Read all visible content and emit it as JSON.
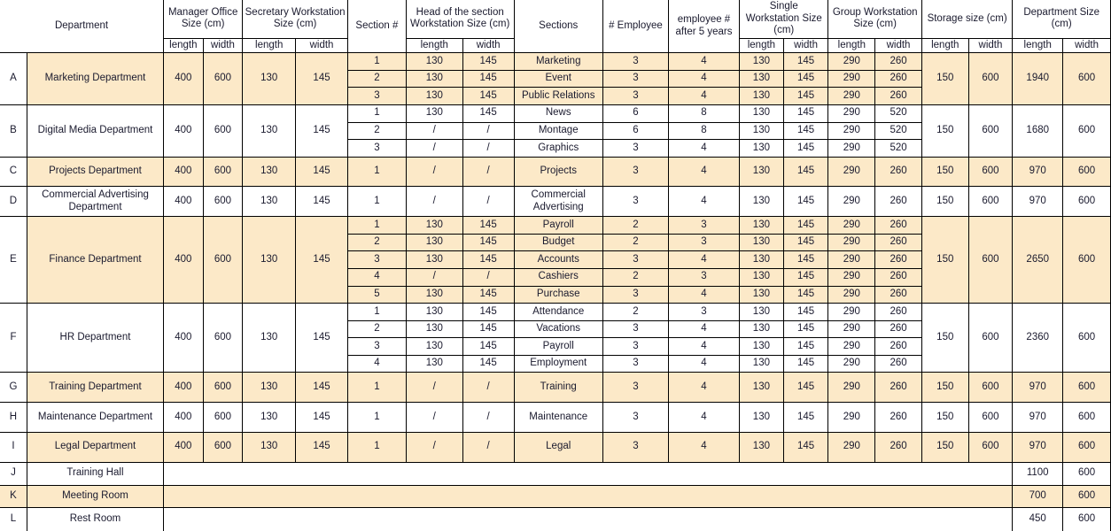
{
  "header": {
    "department": "Department",
    "manager_office": "Manager Office Size (cm)",
    "secretary_ws": "Secretary Workstation Size (cm)",
    "section_num": "Section #",
    "head_section_ws": "Head of the section Workstation Size (cm)",
    "sections": "Sections",
    "num_employee": "# Employee",
    "employee_after5": "employee # after 5 years",
    "single_ws": "Single Workstation Size (cm)",
    "group_ws": "Group Workstation Size (cm)",
    "storage": "Storage size (cm)",
    "department_size": "Department Size (cm)",
    "length": "length",
    "width": "width"
  },
  "colors": {
    "cream": "#fce9c8",
    "white": "#ffffff",
    "grid": "#000000",
    "text": "#1a1a2e"
  },
  "rows": [
    {
      "letter": "A",
      "letter_shaded": false,
      "shaded": true,
      "department": "Marketing Department",
      "manager_office": {
        "length": "400",
        "width": "600"
      },
      "secretary_ws": {
        "length": "130",
        "width": "145"
      },
      "storage": {
        "length": "150",
        "width": "600"
      },
      "department_size": {
        "length": "1940",
        "width": "600"
      },
      "sections": [
        {
          "num": "1",
          "head_l": "130",
          "head_w": "145",
          "name": "Marketing",
          "emp": "3",
          "emp5": "4",
          "single_l": "130",
          "single_w": "145",
          "group_l": "290",
          "group_w": "260"
        },
        {
          "num": "2",
          "head_l": "130",
          "head_w": "145",
          "name": "Event",
          "emp": "3",
          "emp5": "4",
          "single_l": "130",
          "single_w": "145",
          "group_l": "290",
          "group_w": "260"
        },
        {
          "num": "3",
          "head_l": "130",
          "head_w": "145",
          "name": "Public Relations",
          "emp": "3",
          "emp5": "4",
          "single_l": "130",
          "single_w": "145",
          "group_l": "290",
          "group_w": "260"
        }
      ]
    },
    {
      "letter": "B",
      "letter_shaded": false,
      "shaded": false,
      "department": "Digital Media Department",
      "manager_office": {
        "length": "400",
        "width": "600"
      },
      "secretary_ws": {
        "length": "130",
        "width": "145"
      },
      "storage": {
        "length": "150",
        "width": "600"
      },
      "department_size": {
        "length": "1680",
        "width": "600"
      },
      "sections": [
        {
          "num": "1",
          "head_l": "130",
          "head_w": "145",
          "name": "News",
          "emp": "6",
          "emp5": "8",
          "single_l": "130",
          "single_w": "145",
          "group_l": "290",
          "group_w": "520"
        },
        {
          "num": "2",
          "head_l": "/",
          "head_w": "/",
          "name": "Montage",
          "emp": "6",
          "emp5": "8",
          "single_l": "130",
          "single_w": "145",
          "group_l": "290",
          "group_w": "520"
        },
        {
          "num": "3",
          "head_l": "/",
          "head_w": "/",
          "name": "Graphics",
          "emp": "3",
          "emp5": "4",
          "single_l": "130",
          "single_w": "145",
          "group_l": "290",
          "group_w": "520"
        }
      ]
    },
    {
      "letter": "C",
      "letter_shaded": false,
      "shaded": true,
      "department": "Projects Department",
      "manager_office": {
        "length": "400",
        "width": "600"
      },
      "secretary_ws": {
        "length": "130",
        "width": "145"
      },
      "storage": {
        "length": "150",
        "width": "600"
      },
      "department_size": {
        "length": "970",
        "width": "600"
      },
      "sections": [
        {
          "num": "1",
          "head_l": "/",
          "head_w": "/",
          "name": "Projects",
          "emp": "3",
          "emp5": "4",
          "single_l": "130",
          "single_w": "145",
          "group_l": "290",
          "group_w": "260"
        }
      ]
    },
    {
      "letter": "D",
      "letter_shaded": false,
      "shaded": false,
      "department": "Commercial Advertising Department",
      "manager_office": {
        "length": "400",
        "width": "600"
      },
      "secretary_ws": {
        "length": "130",
        "width": "145"
      },
      "storage": {
        "length": "150",
        "width": "600"
      },
      "department_size": {
        "length": "970",
        "width": "600"
      },
      "sections": [
        {
          "num": "1",
          "head_l": "/",
          "head_w": "/",
          "name": "Commercial Advertising",
          "emp": "3",
          "emp5": "4",
          "single_l": "130",
          "single_w": "145",
          "group_l": "290",
          "group_w": "260"
        }
      ]
    },
    {
      "letter": "E",
      "letter_shaded": false,
      "shaded": true,
      "department": "Finance Department",
      "manager_office": {
        "length": "400",
        "width": "600"
      },
      "secretary_ws": {
        "length": "130",
        "width": "145"
      },
      "storage": {
        "length": "150",
        "width": "600"
      },
      "department_size": {
        "length": "2650",
        "width": "600"
      },
      "sections": [
        {
          "num": "1",
          "head_l": "130",
          "head_w": "145",
          "name": "Payroll",
          "emp": "2",
          "emp5": "3",
          "single_l": "130",
          "single_w": "145",
          "group_l": "290",
          "group_w": "260"
        },
        {
          "num": "2",
          "head_l": "130",
          "head_w": "145",
          "name": "Budget",
          "emp": "2",
          "emp5": "3",
          "single_l": "130",
          "single_w": "145",
          "group_l": "290",
          "group_w": "260"
        },
        {
          "num": "3",
          "head_l": "130",
          "head_w": "145",
          "name": "Accounts",
          "emp": "3",
          "emp5": "4",
          "single_l": "130",
          "single_w": "145",
          "group_l": "290",
          "group_w": "260"
        },
        {
          "num": "4",
          "head_l": "/",
          "head_w": "/",
          "name": "Cashiers",
          "emp": "2",
          "emp5": "3",
          "single_l": "130",
          "single_w": "145",
          "group_l": "290",
          "group_w": "260"
        },
        {
          "num": "5",
          "head_l": "130",
          "head_w": "145",
          "name": "Purchase",
          "emp": "3",
          "emp5": "4",
          "single_l": "130",
          "single_w": "145",
          "group_l": "290",
          "group_w": "260"
        }
      ]
    },
    {
      "letter": "F",
      "letter_shaded": false,
      "shaded": false,
      "department": "HR Department",
      "manager_office": {
        "length": "400",
        "width": "600"
      },
      "secretary_ws": {
        "length": "130",
        "width": "145"
      },
      "storage": {
        "length": "150",
        "width": "600"
      },
      "department_size": {
        "length": "2360",
        "width": "600"
      },
      "sections": [
        {
          "num": "1",
          "head_l": "130",
          "head_w": "145",
          "name": "Attendance",
          "emp": "2",
          "emp5": "3",
          "single_l": "130",
          "single_w": "145",
          "group_l": "290",
          "group_w": "260"
        },
        {
          "num": "2",
          "head_l": "130",
          "head_w": "145",
          "name": "Vacations",
          "emp": "3",
          "emp5": "4",
          "single_l": "130",
          "single_w": "145",
          "group_l": "290",
          "group_w": "260"
        },
        {
          "num": "3",
          "head_l": "130",
          "head_w": "145",
          "name": "Payroll",
          "emp": "3",
          "emp5": "4",
          "single_l": "130",
          "single_w": "145",
          "group_l": "290",
          "group_w": "260"
        },
        {
          "num": "4",
          "head_l": "130",
          "head_w": "145",
          "name": "Employment",
          "emp": "3",
          "emp5": "4",
          "single_l": "130",
          "single_w": "145",
          "group_l": "290",
          "group_w": "260"
        }
      ]
    },
    {
      "letter": "G",
      "letter_shaded": false,
      "shaded": true,
      "department": "Training Department",
      "manager_office": {
        "length": "400",
        "width": "600"
      },
      "secretary_ws": {
        "length": "130",
        "width": "145"
      },
      "storage": {
        "length": "150",
        "width": "600"
      },
      "department_size": {
        "length": "970",
        "width": "600"
      },
      "sections": [
        {
          "num": "1",
          "head_l": "/",
          "head_w": "/",
          "name": "Training",
          "emp": "3",
          "emp5": "4",
          "single_l": "130",
          "single_w": "145",
          "group_l": "290",
          "group_w": "260"
        }
      ]
    },
    {
      "letter": "H",
      "letter_shaded": false,
      "shaded": false,
      "department": "Maintenance Department",
      "manager_office": {
        "length": "400",
        "width": "600"
      },
      "secretary_ws": {
        "length": "130",
        "width": "145"
      },
      "storage": {
        "length": "150",
        "width": "600"
      },
      "department_size": {
        "length": "970",
        "width": "600"
      },
      "sections": [
        {
          "num": "1",
          "head_l": "/",
          "head_w": "/",
          "name": "Maintenance",
          "emp": "3",
          "emp5": "4",
          "single_l": "130",
          "single_w": "145",
          "group_l": "290",
          "group_w": "260"
        }
      ]
    },
    {
      "letter": "I",
      "letter_shaded": false,
      "shaded": true,
      "department": "Legal Department",
      "manager_office": {
        "length": "400",
        "width": "600"
      },
      "secretary_ws": {
        "length": "130",
        "width": "145"
      },
      "storage": {
        "length": "150",
        "width": "600"
      },
      "department_size": {
        "length": "970",
        "width": "600"
      },
      "sections": [
        {
          "num": "1",
          "head_l": "/",
          "head_w": "/",
          "name": "Legal",
          "emp": "3",
          "emp5": "4",
          "single_l": "130",
          "single_w": "145",
          "group_l": "290",
          "group_w": "260"
        }
      ]
    },
    {
      "letter": "J",
      "letter_shaded": false,
      "shaded": false,
      "empty_middle": true,
      "department": "Training Hall",
      "department_size": {
        "length": "1100",
        "width": "600"
      },
      "sections": []
    },
    {
      "letter": "K",
      "letter_shaded": true,
      "shaded": true,
      "empty_middle": true,
      "department": "Meeting Room",
      "department_size": {
        "length": "700",
        "width": "600"
      },
      "sections": []
    },
    {
      "letter": "L",
      "letter_shaded": false,
      "shaded": false,
      "empty_middle": true,
      "department": "Rest Room",
      "department_size": {
        "length": "450",
        "width": "600"
      },
      "sections": []
    }
  ]
}
